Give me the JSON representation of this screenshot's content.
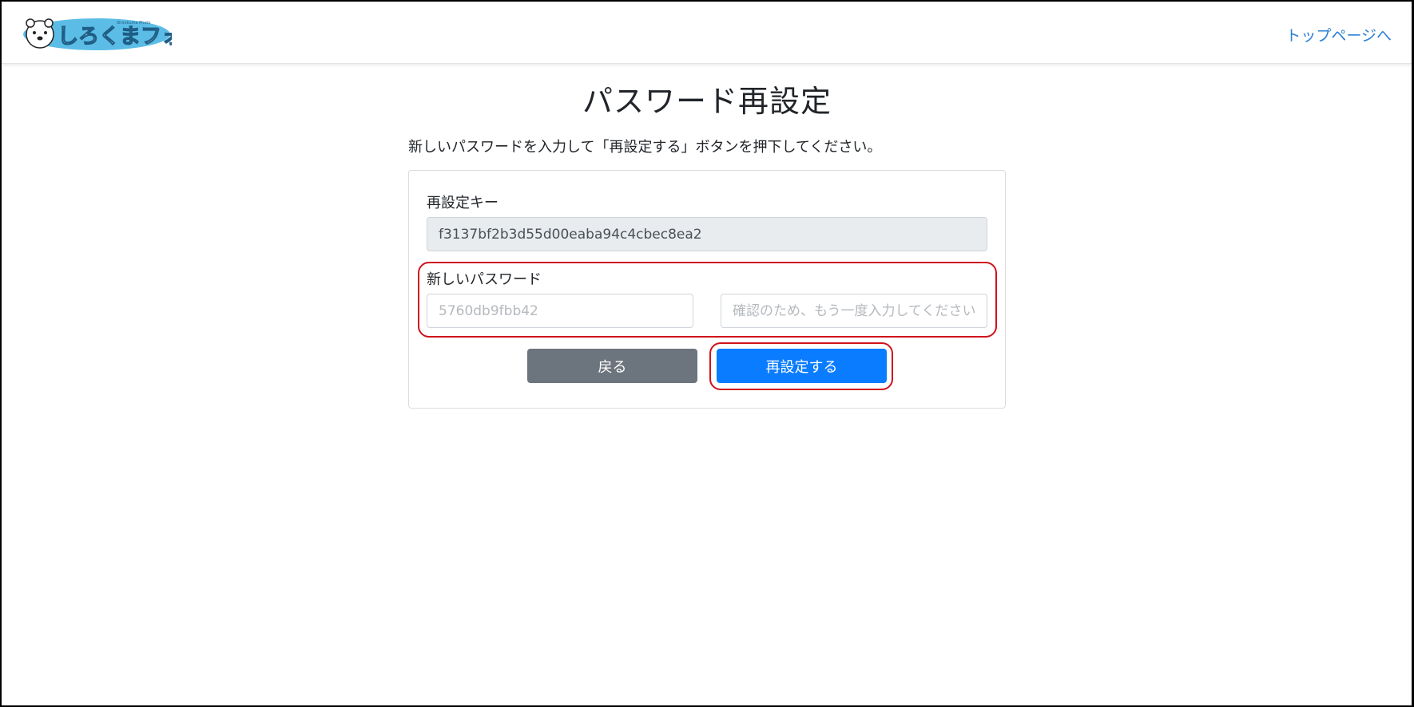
{
  "header": {
    "logo_text": "しろくまフォト",
    "logo_subtext": "Shirokuma Photo",
    "top_link": "トップページへ"
  },
  "main": {
    "title": "パスワード再設定",
    "lead": "新しいパスワードを入力して「再設定する」ボタンを押下してください。",
    "reset_key": {
      "label": "再設定キー",
      "value": "f3137bf2b3d55d00eaba94c4cbec8ea2"
    },
    "new_password": {
      "label": "新しいパスワード",
      "placeholder": "5760db9fbb42",
      "confirm_placeholder": "確認のため、もう一度入力してください"
    },
    "buttons": {
      "back": "戻る",
      "submit": "再設定する"
    }
  },
  "colors": {
    "link": "#2a7fd6",
    "primary": "#0a7cff",
    "secondary": "#6c757d",
    "highlight": "#d0121b",
    "logo_bg": "#5bbde6"
  }
}
